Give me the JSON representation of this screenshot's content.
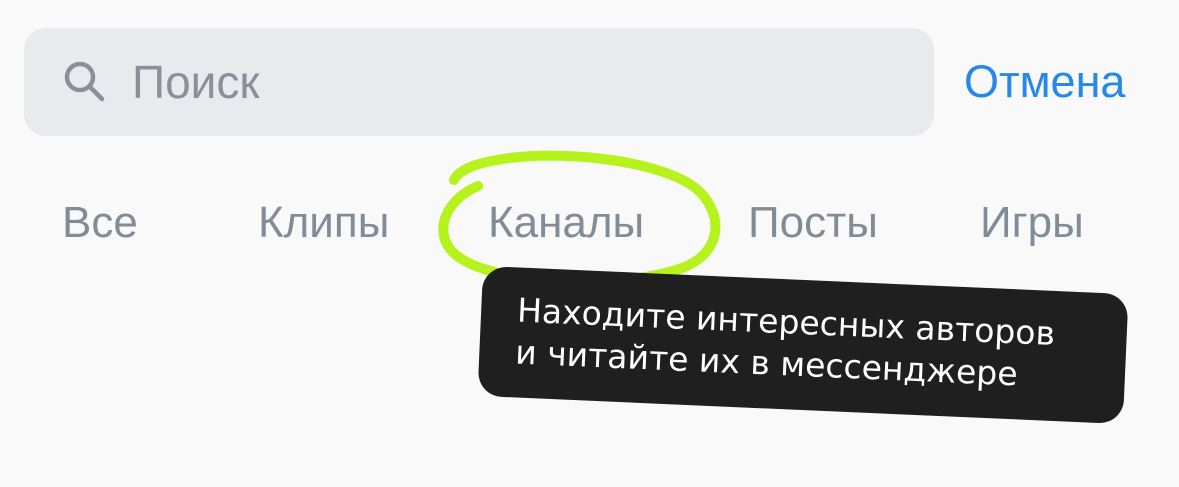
{
  "search": {
    "placeholder": "Поиск",
    "value": "",
    "icon": "search-icon"
  },
  "cancel_label": "Отмена",
  "tabs": [
    {
      "label": "Все"
    },
    {
      "label": "Клипы"
    },
    {
      "label": "Каналы",
      "highlighted": true
    },
    {
      "label": "Посты"
    },
    {
      "label": "Игры"
    }
  ],
  "tooltip": {
    "line1": "Находите интересных авторов",
    "line2": "и читайте их в мессенджере"
  },
  "colors": {
    "accent": "#2688eb",
    "tab_text": "#818c99",
    "highlight": "#b6f21c",
    "tooltip_bg": "#1f1f1f",
    "search_bg": "#e9eaee"
  }
}
